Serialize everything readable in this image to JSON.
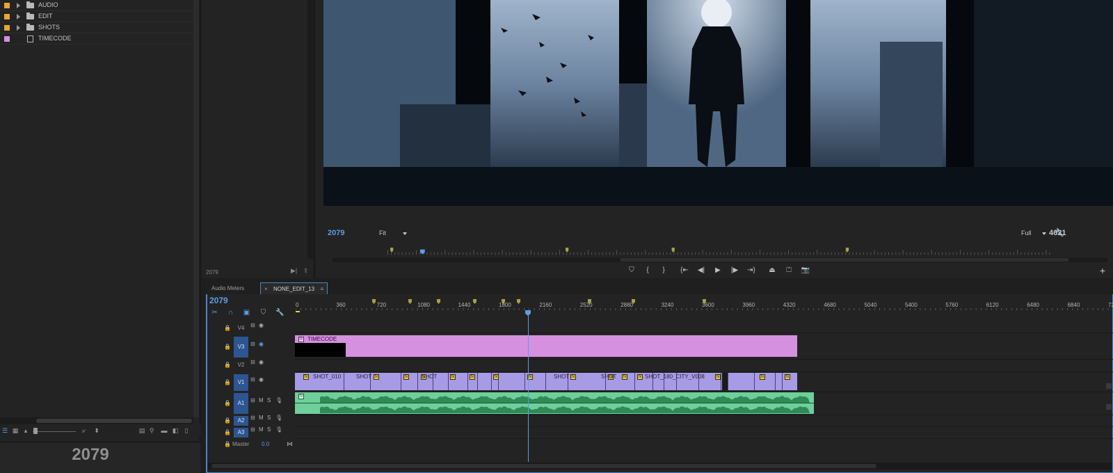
{
  "project": {
    "items": [
      {
        "name": "AUDIO",
        "color": "#e8a634",
        "type": "bin"
      },
      {
        "name": "EDIT",
        "color": "#e8a634",
        "type": "bin"
      },
      {
        "name": "SHOTS",
        "color": "#e8a634",
        "type": "bin"
      },
      {
        "name": "TIMECODE",
        "color": "#d690e0",
        "type": "sequence"
      }
    ],
    "big_timecode": "2079"
  },
  "source": {
    "timecode": "2079"
  },
  "program": {
    "timecode": "2079",
    "fit_label": "Fit",
    "quality_label": "Full",
    "duration": "4621"
  },
  "timeline": {
    "tabs": [
      {
        "label": "Audio Meters"
      },
      {
        "label": "NONE_EDIT_13",
        "close": "×",
        "menu": "≡"
      }
    ],
    "timecode": "2079",
    "ruler_labels": [
      "0",
      "360",
      "720",
      "1080",
      "1440",
      "1800",
      "2160",
      "2520",
      "2880",
      "3240",
      "3600",
      "3960",
      "4320",
      "4680",
      "5040",
      "5400",
      "5760",
      "6120",
      "6480",
      "6840",
      "72"
    ],
    "tracks": [
      {
        "label": "V4"
      },
      {
        "label": "V3"
      },
      {
        "label": "V2"
      },
      {
        "label": "V1"
      },
      {
        "label": "A1"
      },
      {
        "label": "A2"
      },
      {
        "label": "A3"
      }
    ],
    "track_buttons": {
      "mute": "M",
      "solo": "S"
    },
    "master": {
      "label": "Master",
      "value": "0.0"
    },
    "clips": {
      "timecode": "TIMECODE",
      "v1": [
        "SHOT_010",
        "SHOT",
        "SHOT",
        "SHOT",
        "SHOT",
        "SHOT_180_CITY_V008"
      ]
    },
    "colors": {
      "accent": "#5b9ee5",
      "v3_clip": "#d690e0",
      "v1_clip": "#a79be6",
      "audio_clip": "#6fcf9a",
      "marker": "#a5a346"
    }
  }
}
